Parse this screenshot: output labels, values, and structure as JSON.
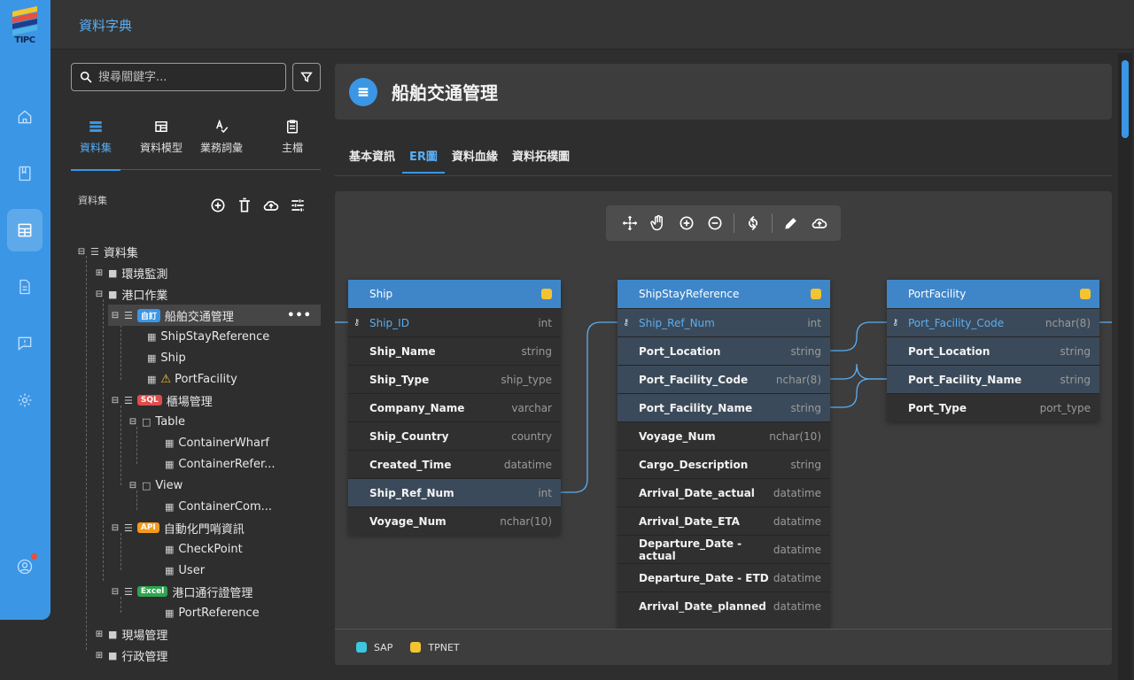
{
  "logo": {
    "text": "TIPC"
  },
  "topbar": {
    "title": "資料字典"
  },
  "rail": {
    "items": [
      "home-icon",
      "book-icon",
      "dataset-icon",
      "document-icon",
      "report-icon",
      "settings-icon"
    ],
    "user": "user-icon"
  },
  "sidebar": {
    "search": {
      "placeholder": "搜尋關鍵字..."
    },
    "categories": [
      {
        "label": "資料集",
        "icon": "list-icon"
      },
      {
        "label": "資料模型",
        "icon": "table-icon"
      },
      {
        "label": "業務詞彙",
        "icon": "spellcheck-icon"
      },
      {
        "label": "主檔",
        "icon": "clipboard-icon"
      }
    ],
    "section_label": "資料集",
    "tree": {
      "root": "資料集",
      "env": "環境監測",
      "port_ops": "港口作業",
      "ship_mgmt": "船舶交通管理",
      "ship_mgmt_badge": "自訂",
      "ship_stay": "ShipStayReference",
      "ship": "Ship",
      "port_facility": "PortFacility",
      "yard": "櫃場管理",
      "yard_badge": "SQL",
      "table_folder": "Table",
      "container_wharf": "ContainerWharf",
      "container_refer": "ContainerRefer...",
      "view_folder": "View",
      "container_com": "ContainerCom...",
      "gate": "自動化門哨資訊",
      "gate_badge": "API",
      "checkpoint": "CheckPoint",
      "user": "User",
      "pass": "港口通行證管理",
      "pass_badge": "Excel",
      "port_reference": "PortReference",
      "site": "現場管理",
      "admin": "行政管理",
      "more": "•••"
    }
  },
  "main": {
    "title": "船舶交通管理",
    "tabs": [
      "基本資訊",
      "ER圖",
      "資料血緣",
      "資料拓樸圖"
    ],
    "active_tab": "ER圖"
  },
  "er": {
    "tables": [
      {
        "name": "Ship",
        "fields": [
          {
            "name": "Ship_ID",
            "type": "int"
          },
          {
            "name": "Ship_Name",
            "type": "string"
          },
          {
            "name": "Ship_Type",
            "type": "ship_type"
          },
          {
            "name": "Company_Name",
            "type": "varchar"
          },
          {
            "name": "Ship_Country",
            "type": "country"
          },
          {
            "name": "Created_Time",
            "type": "datatime"
          },
          {
            "name": "Ship_Ref_Num",
            "type": "int"
          },
          {
            "name": "Voyage_Num",
            "type": "nchar(10)"
          }
        ]
      },
      {
        "name": "ShipStayReference",
        "fields": [
          {
            "name": "Ship_Ref_Num",
            "type": "int"
          },
          {
            "name": "Port_Location",
            "type": "string"
          },
          {
            "name": "Port_Facility_Code",
            "type": "nchar(8)"
          },
          {
            "name": "Port_Facility_Name",
            "type": "string"
          },
          {
            "name": "Voyage_Num",
            "type": "nchar(10)"
          },
          {
            "name": "Cargo_Description",
            "type": "string"
          },
          {
            "name": "Arrival_Date_actual",
            "type": "datatime"
          },
          {
            "name": "Arrival_Date_ETA",
            "type": "datatime"
          },
          {
            "name": "Departure_Date - actual",
            "type": "datatime"
          },
          {
            "name": "Departure_Date - ETD",
            "type": "datatime"
          },
          {
            "name": "Arrival_Date_planned",
            "type": "datatime"
          }
        ]
      },
      {
        "name": "PortFacility",
        "fields": [
          {
            "name": "Port_Facility_Code",
            "type": "nchar(8)"
          },
          {
            "name": "Port_Location",
            "type": "string"
          },
          {
            "name": "Port_Facility_Name",
            "type": "string"
          },
          {
            "name": "Port_Type",
            "type": "port_type"
          }
        ]
      }
    ],
    "legend": [
      {
        "label": "SAP",
        "color": "#3ec6e0"
      },
      {
        "label": "TPNET",
        "color": "#f4c430"
      }
    ]
  },
  "colors": {
    "accent": "#3b96e6",
    "header": "#3f86c9",
    "highlight": "#3b4a5a"
  }
}
